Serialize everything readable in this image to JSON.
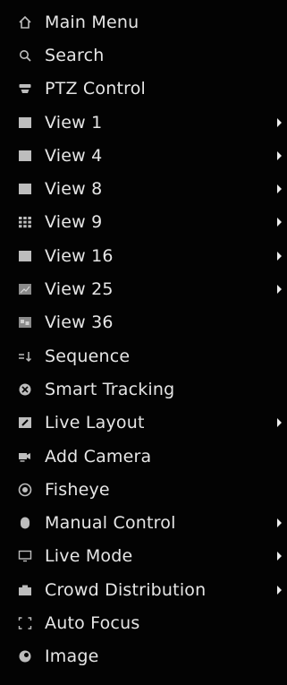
{
  "menu": {
    "items": [
      {
        "label": "Main Menu",
        "icon": "home-icon",
        "submenu": false
      },
      {
        "label": "Search",
        "icon": "search-icon",
        "submenu": false
      },
      {
        "label": "PTZ Control",
        "icon": "ptz-icon",
        "submenu": false
      },
      {
        "label": "View 1",
        "icon": "single-view-icon",
        "submenu": true
      },
      {
        "label": "View 4",
        "icon": "quad-view-icon",
        "submenu": true
      },
      {
        "label": "View 8",
        "icon": "view-8-icon",
        "submenu": true
      },
      {
        "label": "View 9",
        "icon": "grid-9-icon",
        "submenu": true
      },
      {
        "label": "View 16",
        "icon": "grid-16-icon",
        "submenu": true
      },
      {
        "label": "View 25",
        "icon": "grid-25-icon",
        "submenu": true
      },
      {
        "label": "View 36",
        "icon": "grid-36-icon",
        "submenu": false
      },
      {
        "label": "Sequence",
        "icon": "sequence-icon",
        "submenu": false
      },
      {
        "label": "Smart Tracking",
        "icon": "smart-tracking-icon",
        "submenu": false
      },
      {
        "label": "Live Layout",
        "icon": "edit-layout-icon",
        "submenu": true
      },
      {
        "label": "Add Camera",
        "icon": "add-camera-icon",
        "submenu": false
      },
      {
        "label": "Fisheye",
        "icon": "fisheye-icon",
        "submenu": false
      },
      {
        "label": "Manual Control",
        "icon": "manual-control-icon",
        "submenu": true
      },
      {
        "label": "Live Mode",
        "icon": "monitor-icon",
        "submenu": true
      },
      {
        "label": "Crowd Distribution",
        "icon": "crowd-icon",
        "submenu": true
      },
      {
        "label": "Auto Focus",
        "icon": "focus-frame-icon",
        "submenu": false
      },
      {
        "label": "Image",
        "icon": "image-icon",
        "submenu": false
      }
    ]
  },
  "colors": {
    "background": "#030303",
    "text": "#e6e6e6",
    "icon": "#bdbdbd"
  }
}
